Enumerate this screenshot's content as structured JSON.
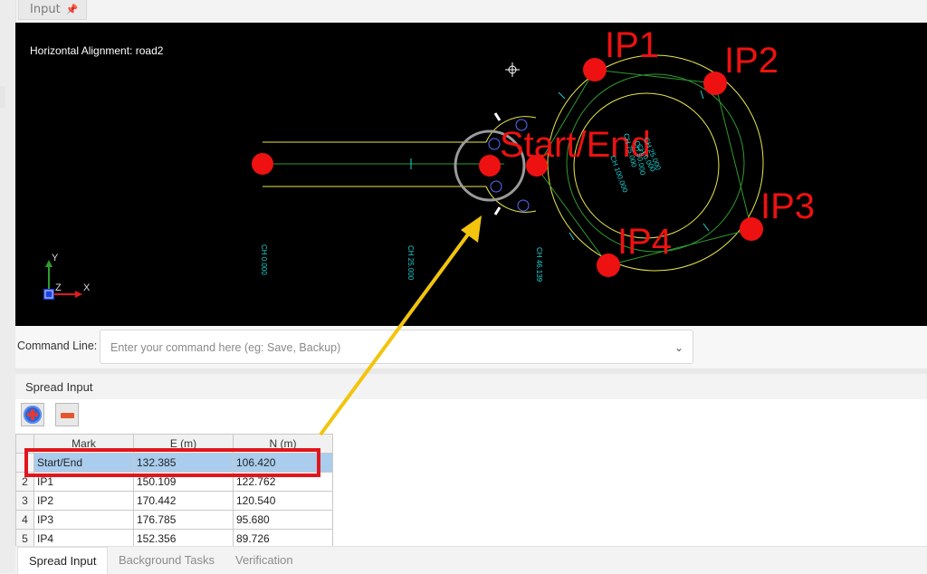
{
  "top_tab": {
    "label": "Input"
  },
  "canvas": {
    "title": "Horizontal Alignment: road2",
    "ip_labels": [
      "IP1",
      "IP2",
      "IP3",
      "IP4",
      "Start/End"
    ],
    "chainage_labels": [
      "CH 0.000",
      "CH 25.000",
      "CH 46.139"
    ],
    "circle_chainages": [
      "CH 0.000",
      "CH 25.000",
      "CH 50.000",
      "CH 75.000",
      "CH 100.000"
    ],
    "axis_y": "Y",
    "axis_x": "X",
    "axis_z": "Z",
    "colors": {
      "background": "#000000",
      "point": "#ee1111",
      "label": "#ee1111",
      "road": "#e8e84a",
      "alignment": "#2f9a2f",
      "chainage": "#19d3d3"
    }
  },
  "command_line": {
    "label": "Command Line:",
    "placeholder": "Enter your command here (eg: Save, Backup)"
  },
  "spread_input": {
    "title": "Spread Input",
    "columns": [
      "Mark",
      "E (m)",
      "N (m)"
    ],
    "rows": [
      {
        "num": "",
        "mark": "Start/End",
        "e": "132.385",
        "n": "106.420",
        "selected": true
      },
      {
        "num": "2",
        "mark": "IP1",
        "e": "150.109",
        "n": "122.762"
      },
      {
        "num": "3",
        "mark": "IP2",
        "e": "170.442",
        "n": "120.540"
      },
      {
        "num": "4",
        "mark": "IP3",
        "e": "176.785",
        "n": "95.680"
      },
      {
        "num": "5",
        "mark": "IP4",
        "e": "152.356",
        "n": "89.726"
      }
    ]
  },
  "bottom_tabs": [
    "Spread Input",
    "Background Tasks",
    "Verification"
  ]
}
